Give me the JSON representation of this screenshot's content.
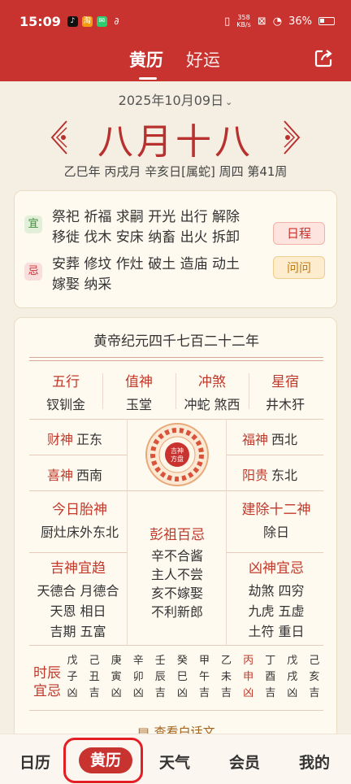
{
  "status": {
    "time": "15:09",
    "speed_top": "358",
    "speed_bottom": "KB/s",
    "battery": "36%",
    "battery_level": 0.36
  },
  "tabs": {
    "active": "黄历",
    "other": "好运"
  },
  "date": "2025年10月09日",
  "lunar": "八月十八",
  "ganzhi": "乙巳年 丙戌月 辛亥日[属蛇] 周四 第41周",
  "yi": {
    "tag": "宜",
    "line1": "祭祀 祈福 求嗣 开光 出行 解除",
    "line2": "移徙 伐木 安床 纳畜 出火 拆卸",
    "button": "日程"
  },
  "ji": {
    "tag": "忌",
    "line1": "安葬 修坟 作灶 破土 造庙 动土",
    "line2": "嫁娶 纳采",
    "button": "问问"
  },
  "era": "黄帝纪元四千七百二十二年",
  "four": [
    {
      "title": "五行",
      "value": "钗钏金"
    },
    {
      "title": "值神",
      "value": "玉堂"
    },
    {
      "title": "冲煞",
      "value": "冲蛇 煞西"
    },
    {
      "title": "星宿",
      "value": "井木犴"
    }
  ],
  "gods": {
    "cai": {
      "k": "财神",
      "v": "正东"
    },
    "xi": {
      "k": "喜神",
      "v": "西南"
    },
    "fu": {
      "k": "福神",
      "v": "西北"
    },
    "yang": {
      "k": "阳贵",
      "v": "东北"
    }
  },
  "center_label": "吉神方盘",
  "taishen": {
    "title": "今日胎神",
    "value": "厨灶床外东北"
  },
  "jianchu": {
    "title": "建除十二神",
    "value": "除日"
  },
  "pengzu": {
    "title": "彭祖百忌",
    "l1": "辛不合酱",
    "l2": "主人不尝",
    "l3": "亥不嫁娶",
    "l4": "不利新郎"
  },
  "jishen": {
    "title": "吉神宜趋",
    "l1": "天德合 月德合",
    "l2": "天恩 相日",
    "l3": "吉期 五富"
  },
  "xiongshen": {
    "title": "凶神宜忌",
    "l1": "劫煞 四穷",
    "l2": "九虎 五虚",
    "l3": "土符 重日"
  },
  "hours_label": {
    "l1": "时辰",
    "l2": "宜忌"
  },
  "hours": [
    {
      "a": "戊",
      "b": "子",
      "c": "凶"
    },
    {
      "a": "己",
      "b": "丑",
      "c": "吉"
    },
    {
      "a": "庚",
      "b": "寅",
      "c": "凶"
    },
    {
      "a": "辛",
      "b": "卯",
      "c": "凶"
    },
    {
      "a": "壬",
      "b": "辰",
      "c": "吉"
    },
    {
      "a": "癸",
      "b": "巳",
      "c": "凶"
    },
    {
      "a": "甲",
      "b": "午",
      "c": "吉"
    },
    {
      "a": "乙",
      "b": "未",
      "c": "吉"
    },
    {
      "a": "丙",
      "b": "申",
      "c": "凶"
    },
    {
      "a": "丁",
      "b": "酉",
      "c": "吉"
    },
    {
      "a": "戊",
      "b": "戌",
      "c": "凶"
    },
    {
      "a": "己",
      "b": "亥",
      "c": "吉"
    }
  ],
  "more": "查看白话文",
  "nav": {
    "n1": "日历",
    "n2": "黄历",
    "n3": "天气",
    "n4": "会员",
    "n5": "我的"
  },
  "colors": {
    "primary": "#c8322f",
    "background": "#f5efe3",
    "card": "#fffaf0"
  }
}
